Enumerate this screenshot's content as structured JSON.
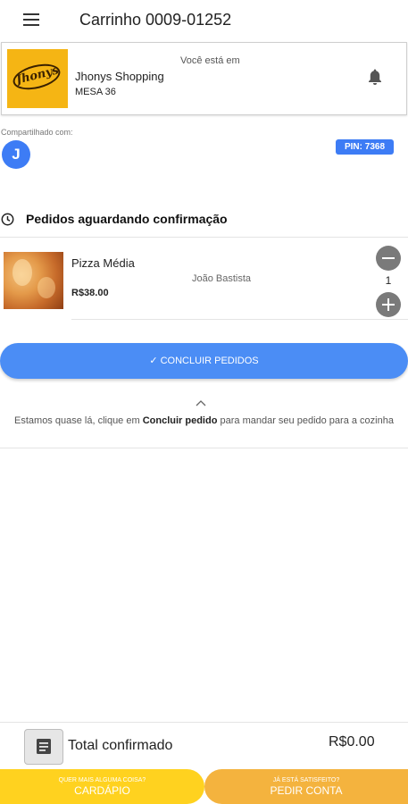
{
  "header": {
    "title": "Carrinho 0009-01252"
  },
  "store": {
    "logo_text": "Jhonys",
    "you_are_in": "Você está em",
    "name": "Jhonys Shopping",
    "table": "MESA 36"
  },
  "sharing": {
    "label": "Compartilhado com:",
    "avatar_initial": "J",
    "pin": "PIN: 7368"
  },
  "pending": {
    "title": "Pedidos aguardando confirmação",
    "items": [
      {
        "name": "Pizza Média",
        "price": "R$38.00",
        "customer": "João Bastista",
        "quantity": "1"
      }
    ]
  },
  "actions": {
    "conclude_label": "✓ CONCLUIR PEDIDOS"
  },
  "hint": {
    "before": "Estamos quase lá, clique em ",
    "bold": "Concluir pedido",
    "after": " para mandar seu pedido para a cozinha"
  },
  "summary": {
    "total_label": "Total confirmado",
    "total_value": "R$0.00"
  },
  "footer": {
    "menu_small": "QUER MAIS ALGUMA COISA?",
    "menu_label": "CARDÁPIO",
    "bill_small": "JÁ ESTÁ SATISFEITO?",
    "bill_label": "PEDIR CONTA"
  },
  "colors": {
    "primary_blue": "#4b8df5",
    "yellow": "#ffd21f",
    "orange": "#f4b33e",
    "logo_bg": "#f5b514"
  }
}
